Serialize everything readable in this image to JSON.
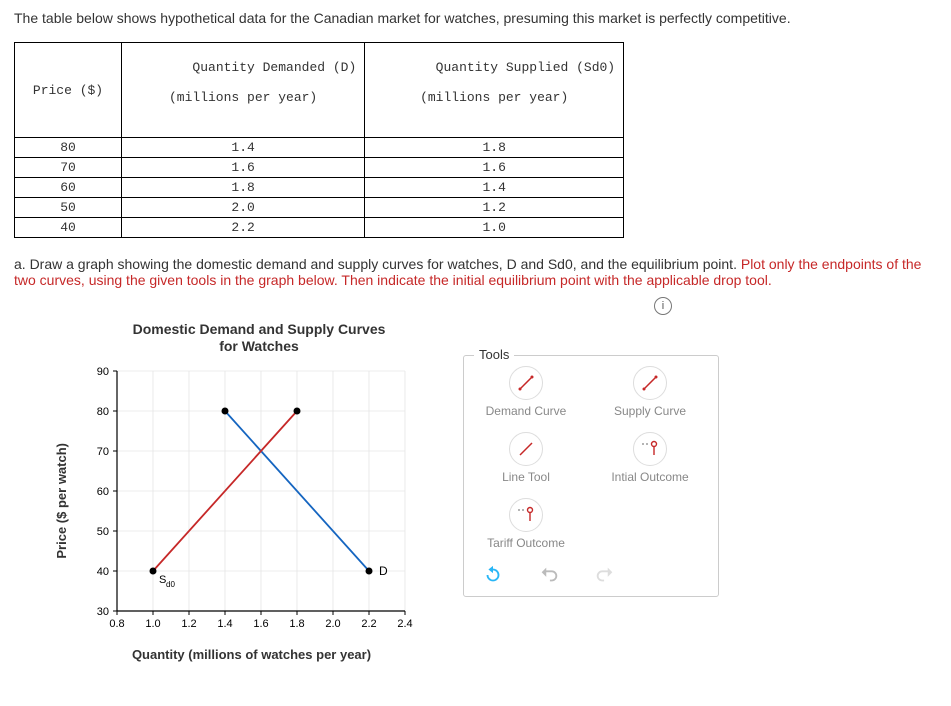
{
  "intro": "The table below shows hypothetical data for the Canadian market for watches, presuming this market is perfectly competitive.",
  "table": {
    "headers": {
      "price": "Price ($)",
      "qd_line1": "Quantity Demanded (D)",
      "qd_line2": "(millions per year)",
      "qs_line1": "Quantity Supplied (Sd0)",
      "qs_line2": "(millions per year)"
    },
    "rows": [
      {
        "price": "80",
        "qd": "1.4",
        "qs": "1.8"
      },
      {
        "price": "70",
        "qd": "1.6",
        "qs": "1.6"
      },
      {
        "price": "60",
        "qd": "1.8",
        "qs": "1.4"
      },
      {
        "price": "50",
        "qd": "2.0",
        "qs": "1.2"
      },
      {
        "price": "40",
        "qd": "2.2",
        "qs": "1.0"
      }
    ]
  },
  "question": {
    "prefix": "a. Draw a graph showing the domestic demand and supply curves for watches, D and Sd0, and the equilibrium point. ",
    "red": "Plot only the endpoints of the two curves, using the given tools in the graph below. Then indicate the initial equilibrium point with the applicable drop tool."
  },
  "chart": {
    "title_line1": "Domestic Demand and Supply Curves",
    "title_line2": "for Watches",
    "ylabel": "Price ($ per watch)",
    "xlabel": "Quantity (millions of watches per year)",
    "label_d": "D",
    "label_s": "Sd0"
  },
  "tools": {
    "legend": "Tools",
    "demand": "Demand Curve",
    "supply": "Supply Curve",
    "line": "Line Tool",
    "initial": "Intial Outcome",
    "tariff": "Tariff Outcome"
  },
  "chart_data": {
    "type": "line",
    "title": "Domestic Demand and Supply Curves for Watches",
    "xlabel": "Quantity (millions of watches per year)",
    "ylabel": "Price ($ per watch)",
    "xlim": [
      0.8,
      2.4
    ],
    "ylim": [
      30,
      90
    ],
    "xticks": [
      0.8,
      1.0,
      1.2,
      1.4,
      1.6,
      1.8,
      2.0,
      2.2,
      2.4
    ],
    "yticks": [
      30,
      40,
      50,
      60,
      70,
      80,
      90
    ],
    "series": [
      {
        "name": "D (Demand)",
        "color": "#1565c0",
        "points": [
          {
            "x": 1.4,
            "y": 80
          },
          {
            "x": 2.2,
            "y": 40
          }
        ]
      },
      {
        "name": "Sd0 (Supply)",
        "color": "#c62828",
        "points": [
          {
            "x": 1.0,
            "y": 40
          },
          {
            "x": 1.8,
            "y": 80
          }
        ]
      }
    ],
    "equilibrium": {
      "x": 1.6,
      "y": 70
    }
  }
}
